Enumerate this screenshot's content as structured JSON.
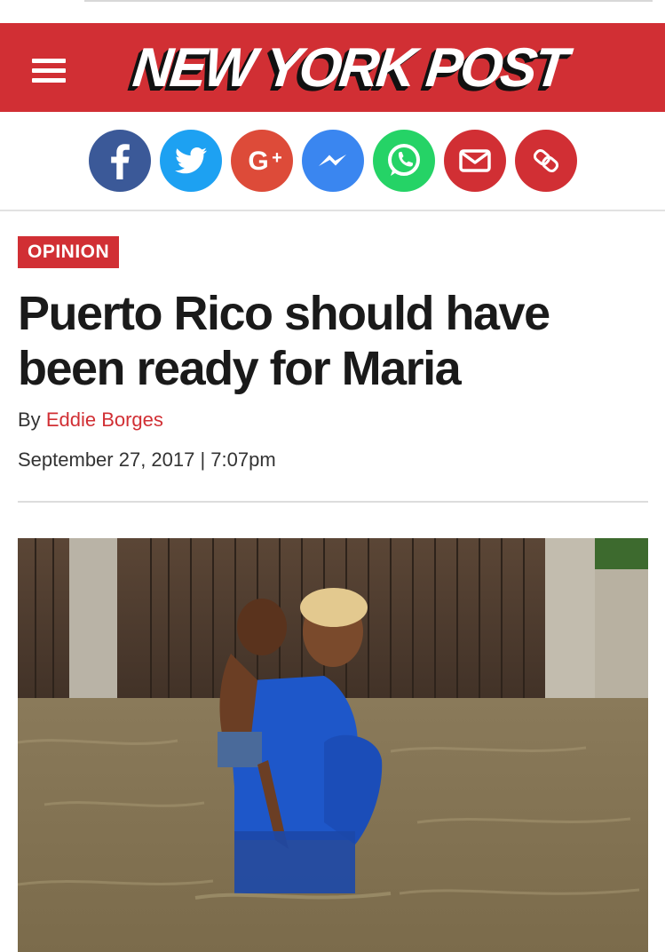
{
  "header": {
    "logo_text": "NEW YORK POST",
    "brand_color": "#d12f34"
  },
  "share": {
    "buttons": [
      {
        "name": "facebook",
        "icon": "facebook-icon",
        "color": "#3b5998"
      },
      {
        "name": "twitter",
        "icon": "twitter-icon",
        "color": "#1da1f2"
      },
      {
        "name": "google-plus",
        "icon": "google-plus-icon",
        "color": "#dd4b39"
      },
      {
        "name": "messenger",
        "icon": "messenger-icon",
        "color": "#3a86f0"
      },
      {
        "name": "whatsapp",
        "icon": "whatsapp-icon",
        "color": "#25d366"
      },
      {
        "name": "email",
        "icon": "email-icon",
        "color": "#d12f34"
      },
      {
        "name": "copy-link",
        "icon": "link-icon",
        "color": "#d12f34"
      }
    ]
  },
  "article": {
    "section": "OPINION",
    "headline": "Puerto Rico should have been ready for Maria",
    "byline_prefix": "By",
    "author": "Eddie Borges",
    "date": "September 27, 2017 | 7:07pm"
  }
}
